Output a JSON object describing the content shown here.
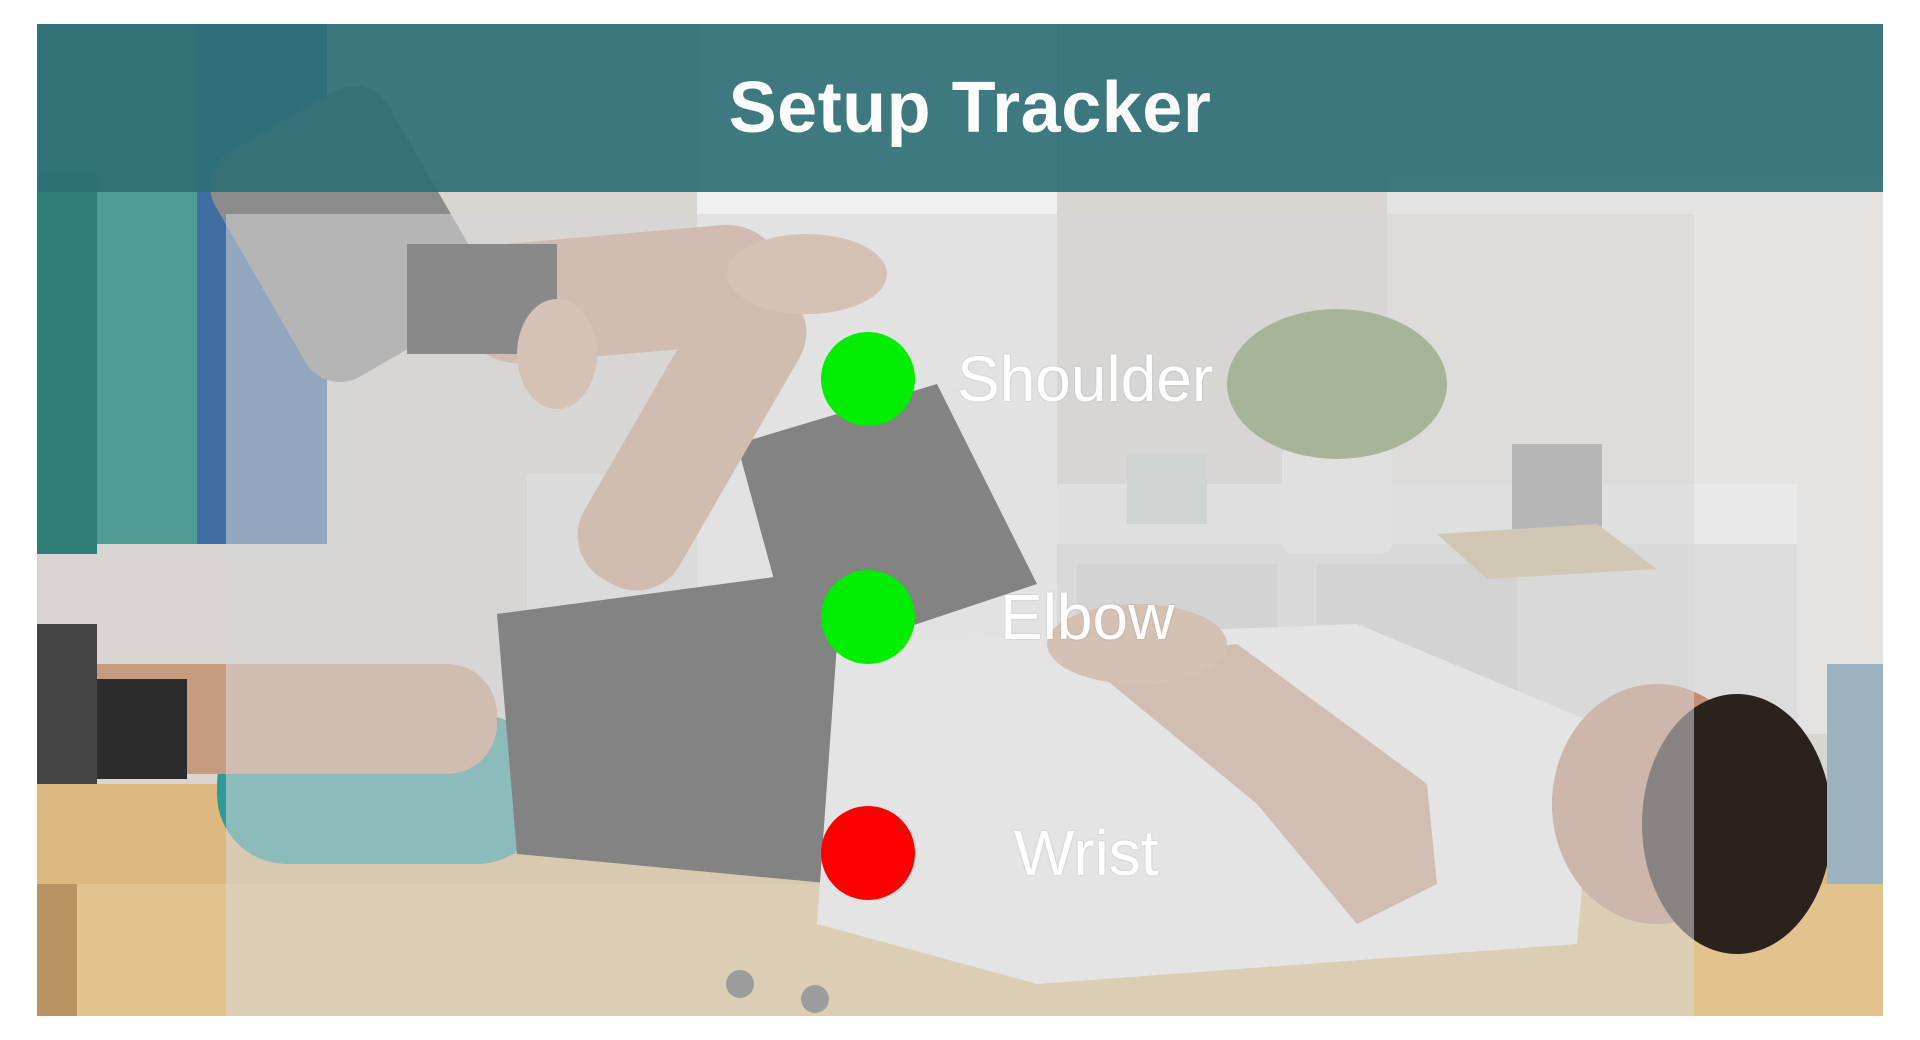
{
  "header": {
    "title": "Setup Tracker",
    "background_color": "#2e6f75"
  },
  "trackers": [
    {
      "label": "Shoulder",
      "status": "connected",
      "color": "#00ee00"
    },
    {
      "label": "Elbow",
      "status": "connected",
      "color": "#00ee00"
    },
    {
      "label": "Wrist",
      "status": "disconnected",
      "color": "#ff0000"
    }
  ],
  "background_image": {
    "subject": "physiotherapy-session-photo"
  }
}
